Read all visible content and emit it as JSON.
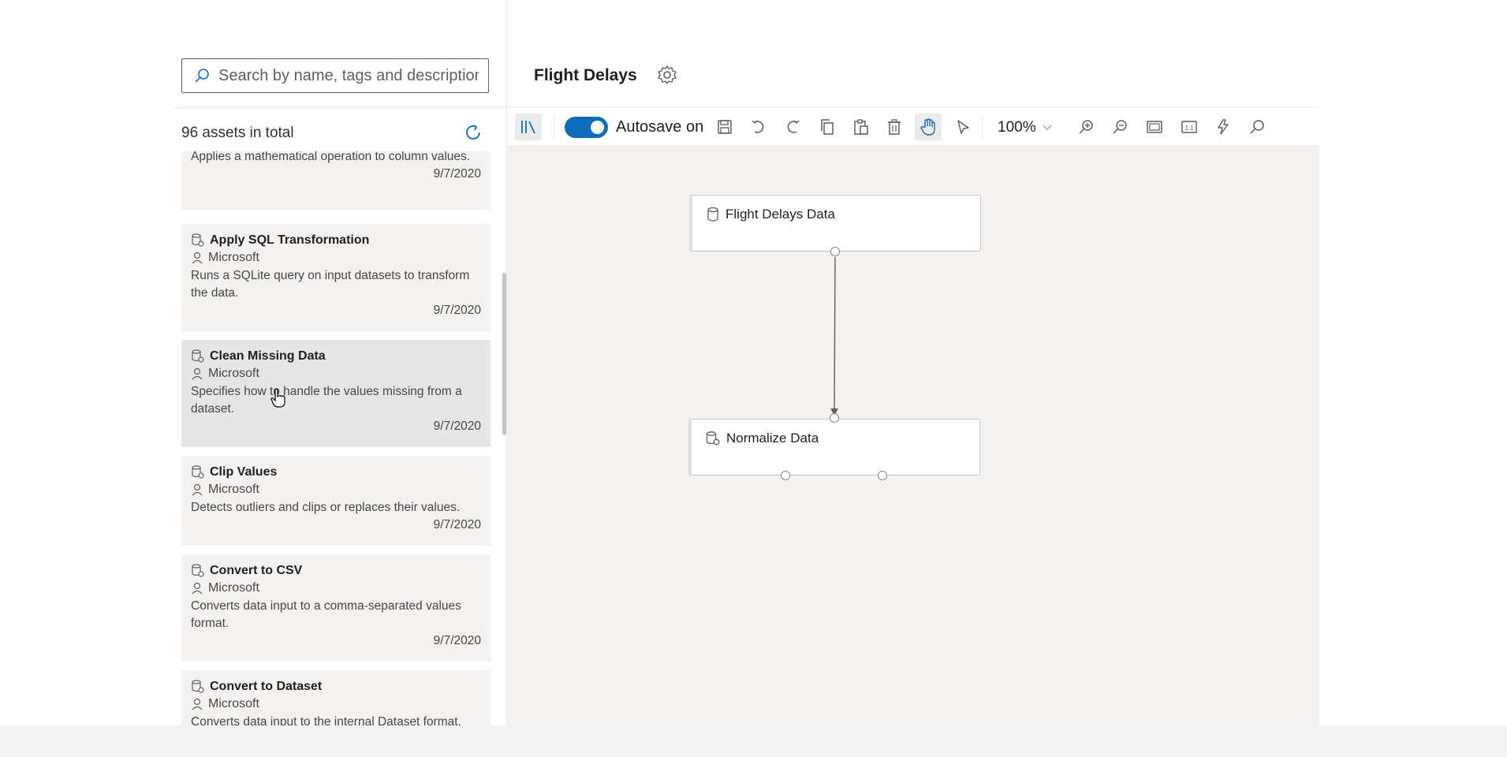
{
  "search": {
    "placeholder": "Search by name, tags and description"
  },
  "assets": {
    "count_label": "96 assets in total"
  },
  "cards": [
    {
      "title": "",
      "author": "",
      "desc": "Applies a mathematical operation to column values.",
      "date": "9/7/2020"
    },
    {
      "title": "Apply SQL Transformation",
      "author": "Microsoft",
      "desc": "Runs a SQLite query on input datasets to transform the data.",
      "date": "9/7/2020"
    },
    {
      "title": "Clean Missing Data",
      "author": "Microsoft",
      "desc": "Specifies how to handle the values missing from a dataset.",
      "date": "9/7/2020"
    },
    {
      "title": "Clip Values",
      "author": "Microsoft",
      "desc": "Detects outliers and clips or replaces their values.",
      "date": "9/7/2020"
    },
    {
      "title": "Convert to CSV",
      "author": "Microsoft",
      "desc": "Converts data input to a comma-separated values format.",
      "date": "9/7/2020"
    },
    {
      "title": "Convert to Dataset",
      "author": "Microsoft",
      "desc": "Converts data input to the internal Dataset format.",
      "date": ""
    }
  ],
  "pipeline": {
    "title": "Flight Delays"
  },
  "toolbar": {
    "autosave_label": "Autosave on",
    "zoom": "100%"
  },
  "nodes": [
    {
      "title": "Flight Delays Data"
    },
    {
      "title": "Normalize Data"
    }
  ],
  "colors": {
    "accent": "#0f6cbd",
    "canvas": "#f3f2f1",
    "card": "#f3f2f1"
  }
}
